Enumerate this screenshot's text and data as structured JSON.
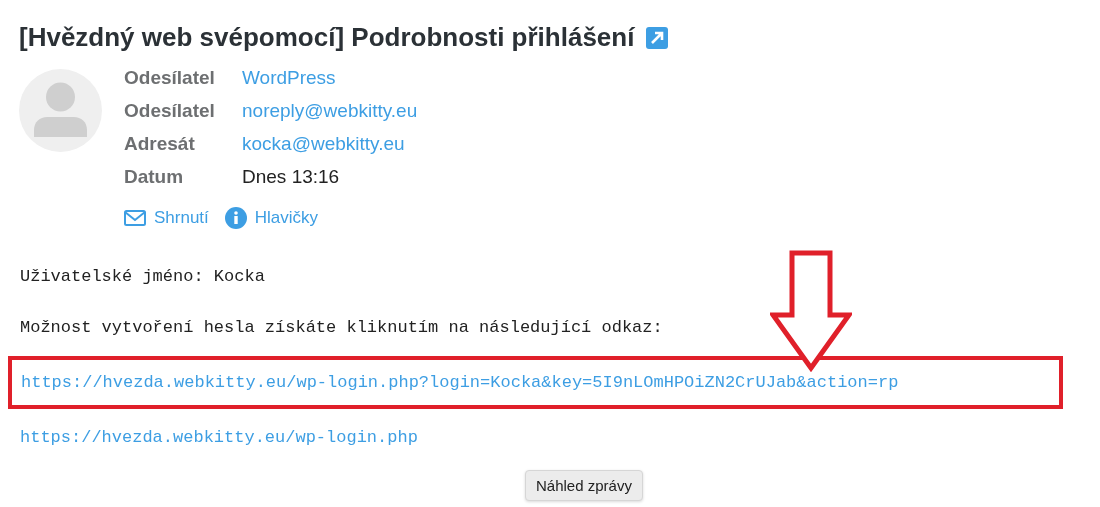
{
  "subject": "[Hvězdný web svépomocí] Podrobnosti přihlášení",
  "headers": [
    {
      "label": "Odesílatel",
      "value": "WordPress",
      "kind": "link"
    },
    {
      "label": "Odesílatel",
      "value": "noreply@webkitty.eu",
      "kind": "link"
    },
    {
      "label": "Adresát",
      "value": "kocka@webkitty.eu",
      "kind": "link"
    },
    {
      "label": "Datum",
      "value": "Dnes 13:16",
      "kind": "text"
    }
  ],
  "views": [
    {
      "label": "Shrnutí",
      "kind": "envelope"
    },
    {
      "label": "Hlavičky",
      "kind": "info"
    }
  ],
  "body": [
    {
      "text": "Uživatelské jméno: Kocka",
      "kind": "text",
      "highlighted": false
    },
    {
      "text": "Možnost vytvoření hesla získáte kliknutím na následující odkaz:",
      "kind": "text",
      "highlighted": false
    },
    {
      "text": "https://hvezda.webkitty.eu/wp-login.php?login=Kocka&key=5I9nLOmHPOiZN2CrUJab&action=rp",
      "kind": "link",
      "highlighted": true
    },
    {
      "text": "https://hvezda.webkitty.eu/wp-login.php",
      "kind": "link",
      "highlighted": false
    }
  ],
  "tooltip": "Náhled zprávy"
}
